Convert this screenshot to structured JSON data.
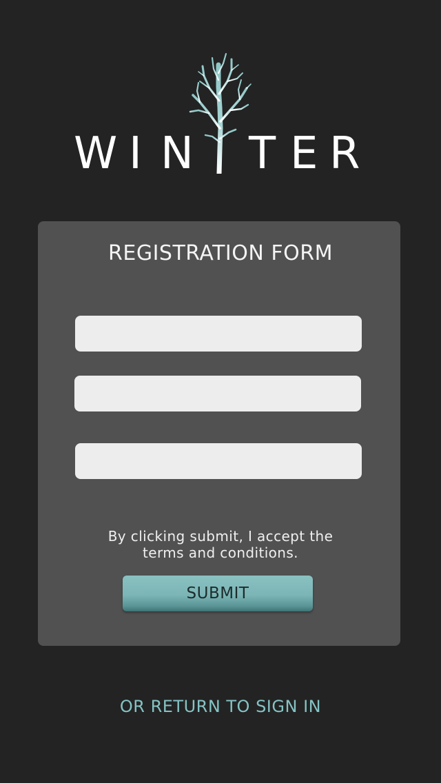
{
  "app": {
    "logo_letters": [
      "W",
      "I",
      "N",
      "T",
      "E",
      "R"
    ],
    "logo_icon": "tree-icon"
  },
  "form": {
    "title": "REGISTRATION FORM",
    "fields": [
      {
        "value": "",
        "placeholder": ""
      },
      {
        "value": "",
        "placeholder": ""
      },
      {
        "value": "",
        "placeholder": ""
      }
    ],
    "terms_line1": "By clicking submit, I accept the",
    "terms_line2": "terms and conditions.",
    "submit_label": "SUBMIT"
  },
  "footer": {
    "signin_link": "OR RETURN TO SIGN IN"
  },
  "colors": {
    "background": "#232323",
    "card": "#515151",
    "field": "#ededed",
    "accent": "#86c3c4",
    "button": "#7cb5b6"
  }
}
